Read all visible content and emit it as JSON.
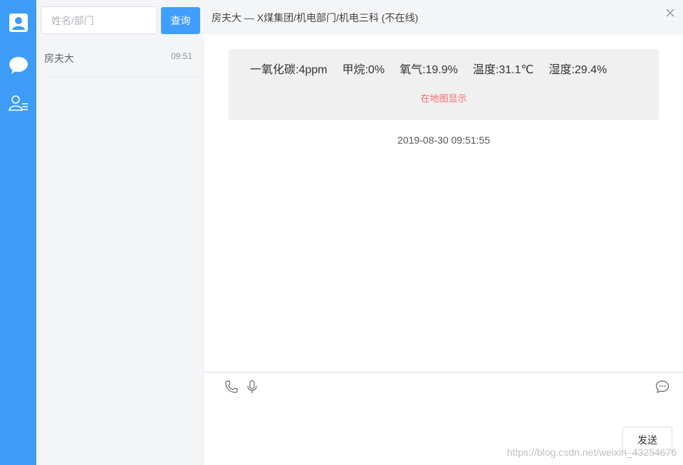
{
  "rail": {
    "items": [
      {
        "icon": "user-card-icon"
      },
      {
        "icon": "chat-bubble-icon"
      },
      {
        "icon": "contacts-list-icon"
      }
    ],
    "bg_color": "#3d9cf8"
  },
  "contacts": {
    "search": {
      "placeholder": "姓名/部门",
      "value": ""
    },
    "search_button": "查询",
    "items": [
      {
        "name": "房夫大",
        "time": "09:51"
      }
    ]
  },
  "chat": {
    "title": "房夫大 — X煤集团/机电部门/机电三科  (不在线)",
    "sensors": [
      {
        "text": "一氧化碳:4ppm"
      },
      {
        "text": "甲烷:0%"
      },
      {
        "text": "氧气:19.9%"
      },
      {
        "text": "温度:31.1℃"
      },
      {
        "text": "湿度:29.4%"
      }
    ],
    "map_link": "在地图显示",
    "message_time": "2019-08-30 09:51:55",
    "send_button": "发送",
    "watermark": "https://blog.csdn.net/weixin_43254676"
  },
  "colors": {
    "accent": "#409eff",
    "link_red": "#f56c6c"
  }
}
